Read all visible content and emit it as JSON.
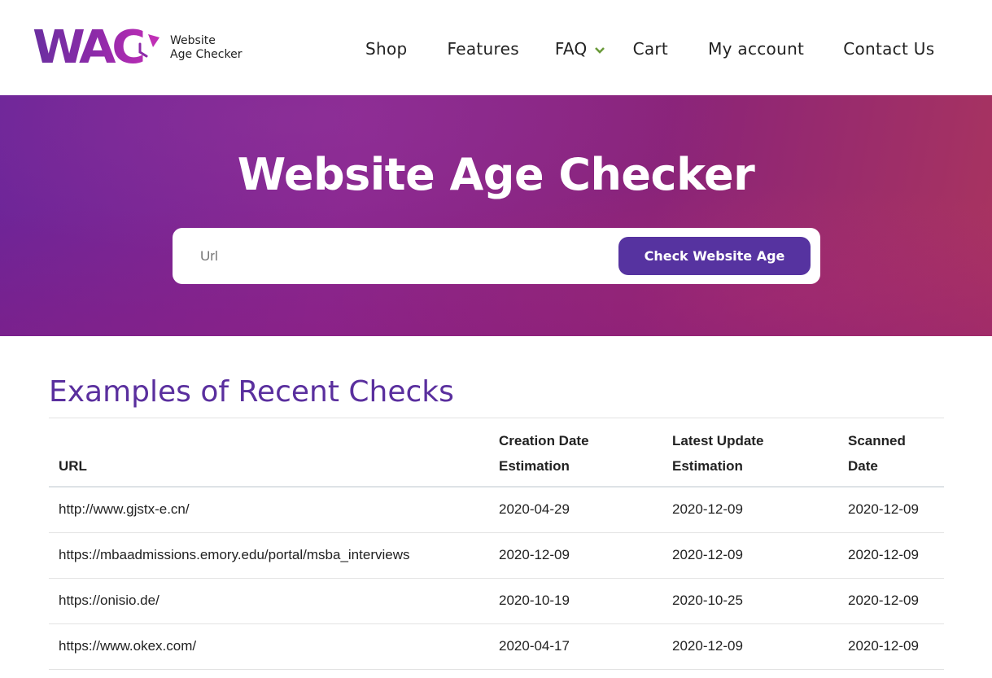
{
  "header": {
    "logo": {
      "mark": "WAC",
      "line1": "Website",
      "line2": "Age Checker",
      "icon": "clock-refresh-icon"
    },
    "nav": [
      {
        "label": "Shop"
      },
      {
        "label": "Features"
      },
      {
        "label": "FAQ",
        "has_dropdown": true,
        "dropdown_icon": "chevron-down-icon"
      },
      {
        "label": "Cart"
      },
      {
        "label": "My account"
      },
      {
        "label": "Contact Us"
      }
    ]
  },
  "hero": {
    "title": "Website Age Checker",
    "search": {
      "placeholder": "Url",
      "value": "",
      "button_label": "Check Website Age"
    }
  },
  "recent": {
    "title": "Examples of Recent Checks",
    "columns": [
      {
        "line1": "",
        "line2": "URL"
      },
      {
        "line1": "Creation Date",
        "line2": "Estimation"
      },
      {
        "line1": "Latest Update",
        "line2": "Estimation"
      },
      {
        "line1": "Scanned",
        "line2": "Date"
      }
    ],
    "rows": [
      {
        "url": "http://www.gjstx-e.cn/",
        "creation": "2020-04-29",
        "update": "2020-12-09",
        "scanned": "2020-12-09"
      },
      {
        "url": "https://mbaadmissions.emory.edu/portal/msba_interviews",
        "creation": "2020-12-09",
        "update": "2020-12-09",
        "scanned": "2020-12-09"
      },
      {
        "url": "https://onisio.de/",
        "creation": "2020-10-19",
        "update": "2020-10-25",
        "scanned": "2020-12-09"
      },
      {
        "url": "https://www.okex.com/",
        "creation": "2020-04-17",
        "update": "2020-12-09",
        "scanned": "2020-12-09"
      }
    ]
  },
  "colors": {
    "brand_purple": "#5633a0",
    "title_purple": "#5a2f9e",
    "nav_chevron_green": "#6a9a3a",
    "hero_left": "#6c2599",
    "hero_right": "#a9345f"
  }
}
